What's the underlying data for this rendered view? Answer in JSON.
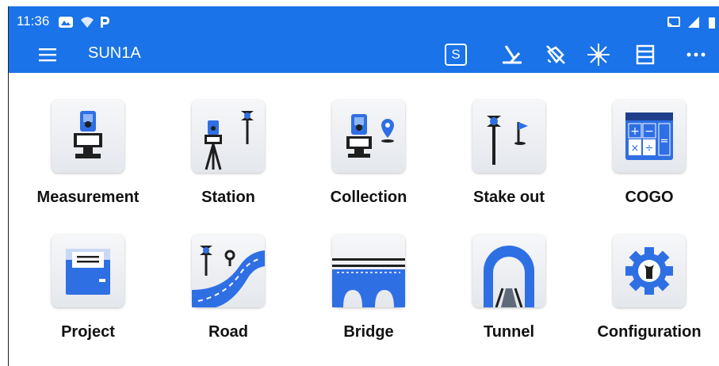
{
  "status_bar": {
    "time": "11:36",
    "icons": [
      "photos-icon",
      "wifi-icon",
      "parking-icon",
      "cast-icon",
      "signal-icon",
      "battery-icon"
    ]
  },
  "toolbar": {
    "title": "SUN1A",
    "s_label": "S",
    "actions": [
      "survey-tool-icon",
      "no-satellite-icon",
      "laser-star-icon",
      "list-icon",
      "more-icon"
    ]
  },
  "menu": [
    {
      "label": "Measurement",
      "icon": "measurement-icon"
    },
    {
      "label": "Station",
      "icon": "station-icon"
    },
    {
      "label": "Collection",
      "icon": "collection-icon"
    },
    {
      "label": "Stake out",
      "icon": "stake-out-icon"
    },
    {
      "label": "COGO",
      "icon": "cogo-icon"
    },
    {
      "label": "Project",
      "icon": "project-icon"
    },
    {
      "label": "Road",
      "icon": "road-icon"
    },
    {
      "label": "Bridge",
      "icon": "bridge-icon"
    },
    {
      "label": "Tunnel",
      "icon": "tunnel-icon"
    },
    {
      "label": "Configuration",
      "icon": "configuration-icon"
    }
  ],
  "colors": {
    "accent": "#1a73e8",
    "icon_blue": "#2f6fe4",
    "dark": "#1f1f1f"
  }
}
